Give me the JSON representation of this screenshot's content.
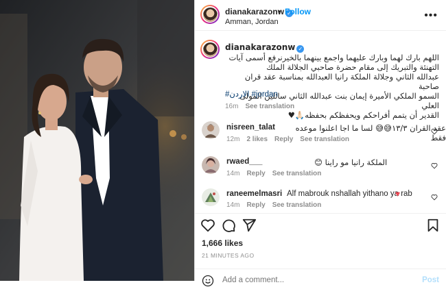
{
  "post": {
    "username": "dianakarazonw",
    "follow_label": "Follow",
    "separator": "•",
    "location": "Amman, Jordan",
    "more_icon": "more-horizontal-icon"
  },
  "caption": {
    "username": "dianakarazonw",
    "text_lines": [
      "اللهم بارك لهما وبارك عليهما واجمع بينهما بالخير",
      "نرفع أسمى آيات التهنئة والتبريك إلى مقام حضرة صاحبي الجلالة الملك",
      "عبدالله الثاني وجلالة الملكة رانيا العبدالله بمناسبة عقد قران صاحبة",
      "السمو الملكي الأميرة إيمان بنت عبدالله الثاني سائلين المولى العلي",
      "القدير أن يتمم أفراحكم ويحفظكم بحفظه🙏🏻♥"
    ],
    "hashtags": "#الاردن #jordan",
    "time": "16m",
    "see_translation": "See translation"
  },
  "comments": [
    {
      "username": "nisreen_talat",
      "text": "عقد القران ١٣/٣😅😅 لسا ما اجا اعلنوا موعده فقط",
      "time": "12m",
      "likes": "2 likes",
      "reply": "Reply",
      "see_translation": "See translation"
    },
    {
      "username": "rwaed___",
      "text": "الملكة رانيا مو راينا 😊",
      "time": "14m",
      "likes": "",
      "reply": "Reply",
      "see_translation": "See translation"
    },
    {
      "username": "raneemelmasri",
      "text": "Alf mabrouk nshallah yithano ya rab",
      "time": "14m",
      "likes": "",
      "reply": "Reply",
      "see_translation": "See translation"
    }
  ],
  "actions": {
    "like_icon": "heart-icon",
    "comment_icon": "comment-icon",
    "share_icon": "send-icon",
    "save_icon": "bookmark-icon"
  },
  "likes": "1,666 likes",
  "time_ago": "21 MINUTES AGO",
  "add_comment": {
    "placeholder": "Add a comment...",
    "post_label": "Post"
  },
  "colors": {
    "accent": "#0095f6",
    "verified": "#3897f0",
    "hashtag": "#00376b",
    "muted": "#8e8e8e",
    "heart": "#ed4956"
  }
}
